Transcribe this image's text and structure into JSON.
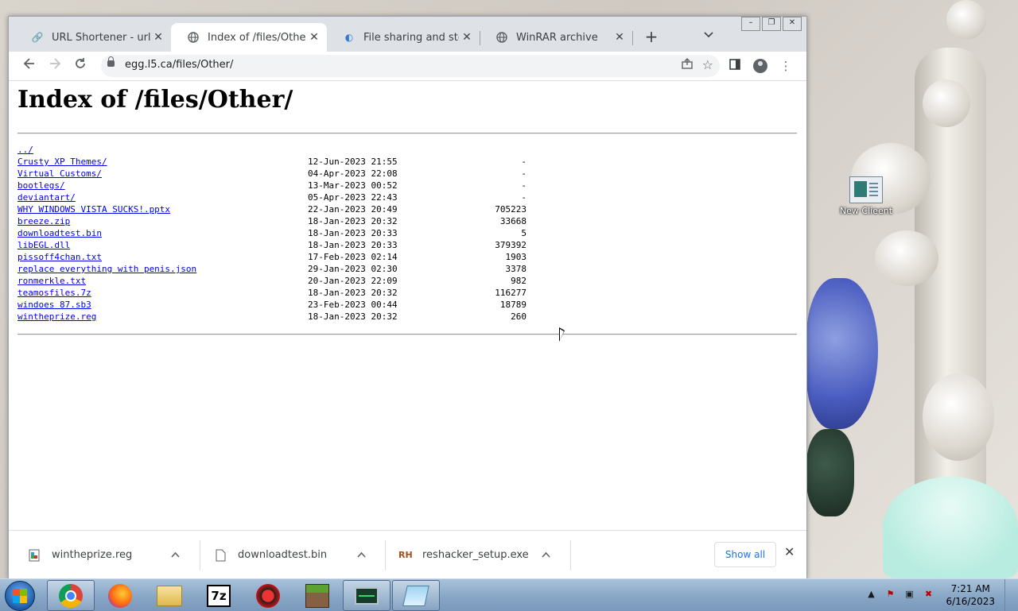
{
  "browser": {
    "tabs": [
      {
        "title": "URL Shortener - url shor",
        "active": false
      },
      {
        "title": "Index of /files/Other/",
        "active": true
      },
      {
        "title": "File sharing and storage",
        "active": false
      },
      {
        "title": "WinRAR archive",
        "active": false
      }
    ],
    "new_tab_label": "+",
    "tab_list_label": "⌄",
    "url": "egg.l5.ca/files/Other/"
  },
  "page": {
    "heading": "Index of /files/Other/",
    "parent_link": "../",
    "entries": [
      {
        "name": "Crusty XP Themes/",
        "date": "12-Jun-2023 21:55",
        "size": "-"
      },
      {
        "name": "Virtual Customs/",
        "date": "04-Apr-2023 22:08",
        "size": "-"
      },
      {
        "name": "bootlegs/",
        "date": "13-Mar-2023 00:52",
        "size": "-"
      },
      {
        "name": "deviantart/",
        "date": "05-Apr-2023 22:43",
        "size": "-"
      },
      {
        "name": "WHY WINDOWS VISTA SUCKS!.pptx",
        "date": "22-Jan-2023 20:49",
        "size": "705223"
      },
      {
        "name": "breeze.zip",
        "date": "18-Jan-2023 20:32",
        "size": "33668"
      },
      {
        "name": "downloadtest.bin",
        "date": "18-Jan-2023 20:33",
        "size": "5"
      },
      {
        "name": "libEGL.dll",
        "date": "18-Jan-2023 20:33",
        "size": "379392"
      },
      {
        "name": "pissoff4chan.txt",
        "date": "17-Feb-2023 02:14",
        "size": "1903"
      },
      {
        "name": "replace everything with penis.json",
        "date": "29-Jan-2023 02:30",
        "size": "3378"
      },
      {
        "name": "ronmerkle.txt",
        "date": "20-Jan-2023 22:09",
        "size": "982"
      },
      {
        "name": "teamosfiles.7z",
        "date": "18-Jan-2023 20:32",
        "size": "116277"
      },
      {
        "name": "windoes 87.sb3",
        "date": "23-Feb-2023 00:44",
        "size": "18789"
      },
      {
        "name": "wintheprize.reg",
        "date": "18-Jan-2023 20:32",
        "size": "260"
      }
    ]
  },
  "downloads": {
    "items": [
      {
        "name": "wintheprize.reg",
        "icon": "reg-file-icon"
      },
      {
        "name": "downloadtest.bin",
        "icon": "file-icon"
      },
      {
        "name": "reshacker_setup.exe",
        "icon": "reshacker-icon"
      }
    ],
    "show_all_label": "Show all"
  },
  "desktop": {
    "icon_label": "New Clieent"
  },
  "taskbar": {
    "apps": [
      "chrome",
      "firefox",
      "file-explorer",
      "7-zip",
      "ccleaner",
      "minecraft",
      "task-manager",
      "notepad"
    ],
    "time": "7:21 AM",
    "date": "6/16/2023"
  }
}
